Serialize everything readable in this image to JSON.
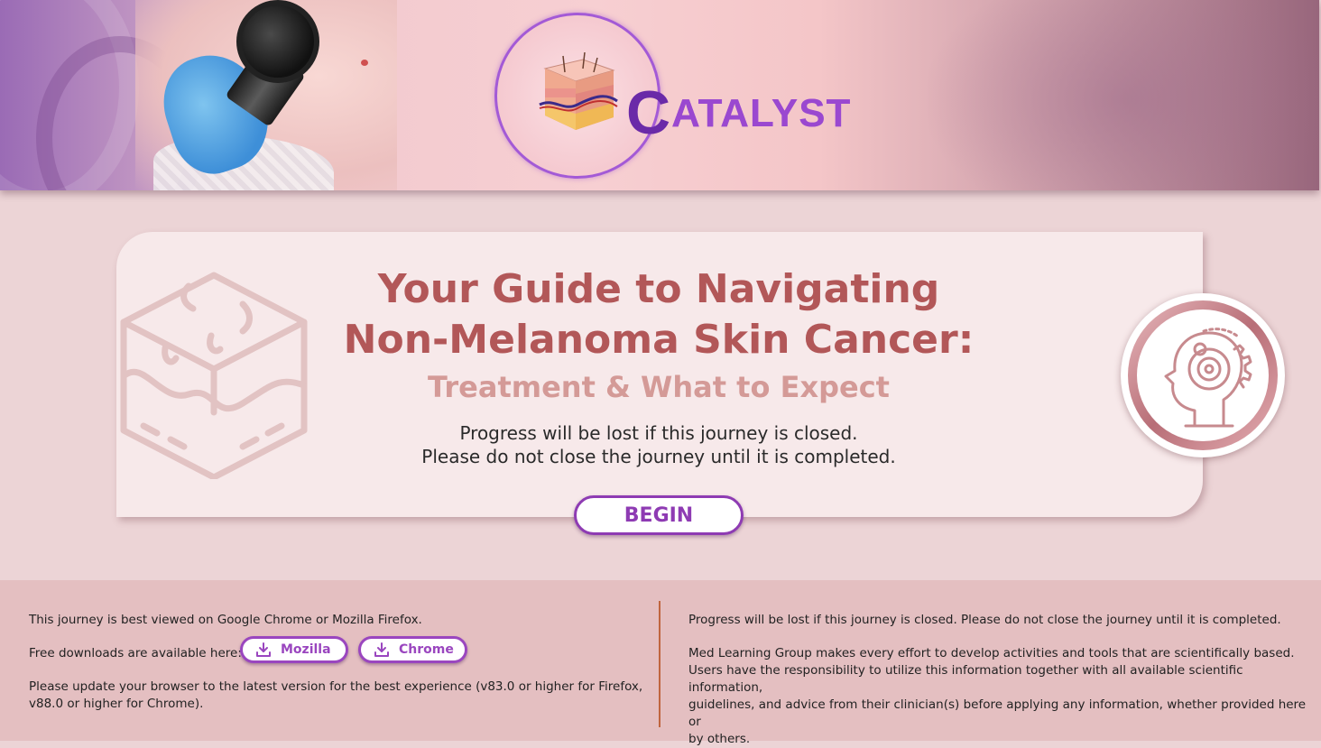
{
  "header": {
    "logo_initial": "C",
    "logo_rest": "ATALYST"
  },
  "hero": {
    "title_line1": "Your Guide to Navigating",
    "title_line2": "Non-Melanoma Skin Cancer:",
    "subtitle": "Treatment & What to Expect",
    "warning_line1": "Progress will be lost if this journey is closed.",
    "warning_line2": "Please do not close the journey until it is completed.",
    "begin_label": "BEGIN"
  },
  "footer": {
    "left": {
      "browser_note": "This journey is best viewed on Google Chrome or Mozilla Firefox.",
      "downloads_label": "Free downloads are available here:",
      "mozilla_label": "Mozilla",
      "chrome_label": "Chrome",
      "update_note_line1": "Please update your browser to the latest version for the best experience (v83.0 or higher for Firefox,",
      "update_note_line2": "v88.0 or higher for Chrome)."
    },
    "right": {
      "progress_note": "Progress will be lost if this journey is closed. Please do not close the journey until it is completed.",
      "disclaimer_line1": "Med Learning Group makes every effort to develop activities and tools that are scientifically based.",
      "disclaimer_line2": "Users have the responsibility to utilize this information together with all available scientific information,",
      "disclaimer_line3": "guidelines, and advice from their clinician(s) before applying any information, whether provided here or",
      "disclaimer_line4": "by others."
    }
  },
  "colors": {
    "title": "#b25758",
    "subtitle": "#d49a97",
    "accent_purple": "#8e3bb3",
    "background": "#ecd4d6",
    "footer_bg": "#e4bfc1",
    "divider": "#c0653f"
  },
  "icons": [
    "skin-layers-icon",
    "head-gear-icon",
    "download-icon"
  ]
}
